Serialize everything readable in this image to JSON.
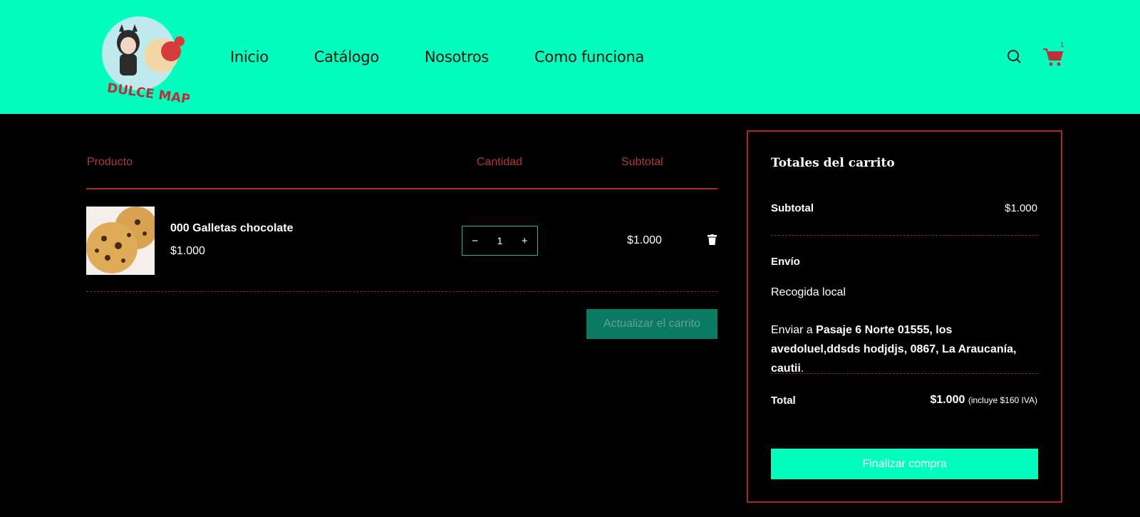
{
  "brand": {
    "logo_text": "DULCE MAPU"
  },
  "nav": {
    "items": [
      {
        "label": "Inicio"
      },
      {
        "label": "Catálogo"
      },
      {
        "label": "Nosotros"
      },
      {
        "label": "Como funciona"
      }
    ]
  },
  "header": {
    "cart_count": "1"
  },
  "cart": {
    "headers": {
      "product": "Producto",
      "quantity": "Cantidad",
      "subtotal": "Subtotal"
    },
    "items": [
      {
        "name": "000 Galletas chocolate",
        "price": "$1.000",
        "quantity": "1",
        "subtotal": "$1.000"
      }
    ],
    "qty_minus": "−",
    "qty_plus": "+",
    "update_button": "Actualizar el carrito"
  },
  "totals": {
    "title": "Totales del carrito",
    "subtotal_label": "Subtotal",
    "subtotal_value": "$1.000",
    "shipping_label": "Envío",
    "shipping_method": "Recogida local",
    "ship_to_prefix": "Enviar a ",
    "ship_to_address": "Pasaje 6 Norte 01555, los avedoluel,ddsds hodjdjs, 0867, La Araucanía, cautii",
    "ship_to_suffix": ".",
    "total_label": "Total",
    "total_value": "$1.000",
    "total_tax_note": "(incluye $160 IVA)",
    "checkout_button": "Finalizar compra"
  },
  "colors": {
    "header_bg": "#00ffbf",
    "accent_red": "#b03a3a",
    "button_green": "#0b7a62",
    "page_bg": "#000000"
  },
  "icons": {
    "search": "search-icon",
    "cart": "cart-icon",
    "trash": "trash-icon"
  }
}
